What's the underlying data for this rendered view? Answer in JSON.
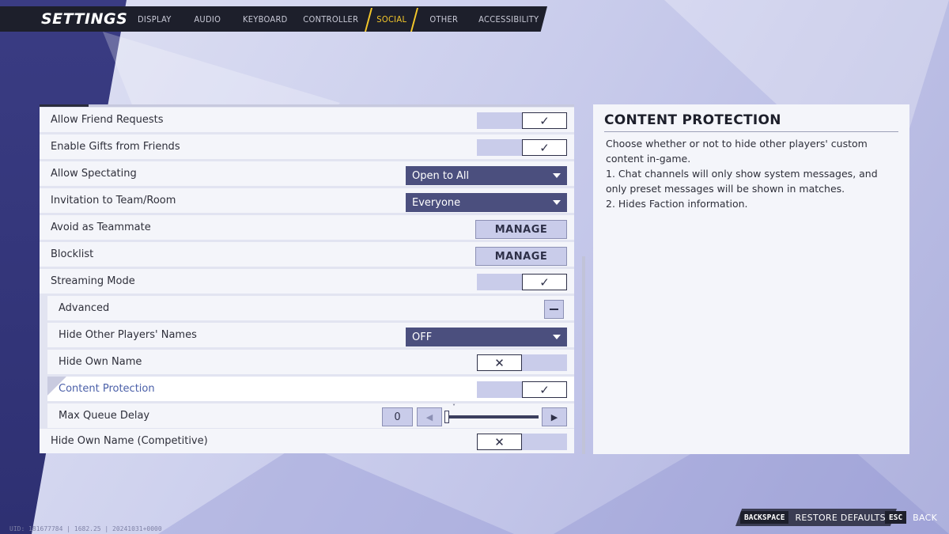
{
  "header": {
    "title": "SETTINGS",
    "tabs": [
      {
        "label": "DISPLAY",
        "active": false
      },
      {
        "label": "AUDIO",
        "active": false
      },
      {
        "label": "KEYBOARD",
        "active": false
      },
      {
        "label": "CONTROLLER",
        "active": false
      },
      {
        "label": "SOCIAL",
        "active": true
      },
      {
        "label": "OTHER",
        "active": false
      },
      {
        "label": "ACCESSIBILITY",
        "active": false
      }
    ]
  },
  "settings": {
    "rows": [
      {
        "label": "Allow Friend Requests",
        "control": "toggle",
        "value": "on"
      },
      {
        "label": "Enable Gifts from Friends",
        "control": "toggle",
        "value": "on"
      },
      {
        "label": "Allow Spectating",
        "control": "dropdown",
        "value": "Open to All"
      },
      {
        "label": "Invitation to Team/Room",
        "control": "dropdown",
        "value": "Everyone"
      },
      {
        "label": "Avoid as Teammate",
        "control": "button",
        "value": "MANAGE"
      },
      {
        "label": "Blocklist",
        "control": "button",
        "value": "MANAGE"
      },
      {
        "label": "Streaming Mode",
        "control": "toggle",
        "value": "on"
      },
      {
        "label": "Advanced",
        "control": "collapse",
        "value": "expanded"
      },
      {
        "label": "Hide Other Players' Names",
        "control": "dropdown",
        "value": "OFF"
      },
      {
        "label": "Hide Own Name",
        "control": "toggle",
        "value": "off"
      },
      {
        "label": "Content Protection",
        "control": "toggle",
        "value": "on"
      },
      {
        "label": "Max Queue Delay",
        "control": "slider",
        "value": "0"
      },
      {
        "label": "Hide Own Name (Competitive)",
        "control": "toggle",
        "value": "off"
      }
    ],
    "check_glyph": "✓",
    "x_glyph": "✕",
    "slider_left_glyph": "◀",
    "slider_right_glyph": "▶",
    "slider_caret_glyph": "˅"
  },
  "info": {
    "title": "CONTENT PROTECTION",
    "paragraphs": [
      "Choose whether or not to hide other players' custom content in-game.",
      "1. Chat channels will only show system messages, and only preset messages will be shown in matches.",
      "2. Hides Faction information."
    ]
  },
  "footer": {
    "restore_key": "BACKSPACE",
    "restore_label": "RESTORE DEFAULTS",
    "back_key": "ESC",
    "back_label": "BACK",
    "uid": "UID: 181677784 | 1682.25 | 20241031+0000"
  },
  "colors": {
    "accent": "#f5c82a",
    "topbar": "#1d1f2b",
    "dropdown": "#4b4f7e",
    "selected_text": "#4a5fa8"
  }
}
